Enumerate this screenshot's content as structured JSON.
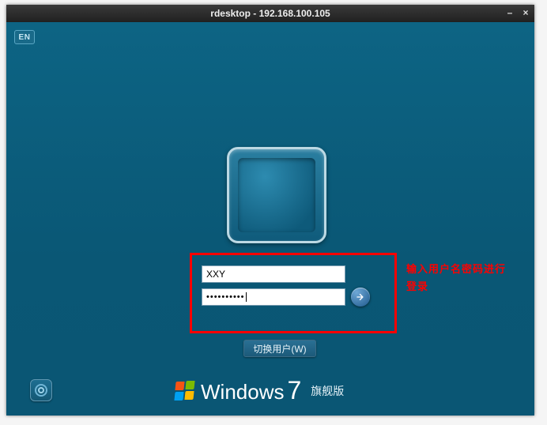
{
  "titlebar": {
    "title": "rdesktop - 192.168.100.105",
    "minimize_glyph": "–",
    "close_glyph": "×"
  },
  "lang_badge": "EN",
  "credentials": {
    "username_value": "XXY",
    "password_masked": "••••••••••"
  },
  "switch_user_label": "切换用户(W)",
  "branding": {
    "name": "Windows",
    "version": "7",
    "edition": "旗舰版"
  },
  "annotation": {
    "line1": "输入用户名密码进行",
    "line2": "登录"
  }
}
